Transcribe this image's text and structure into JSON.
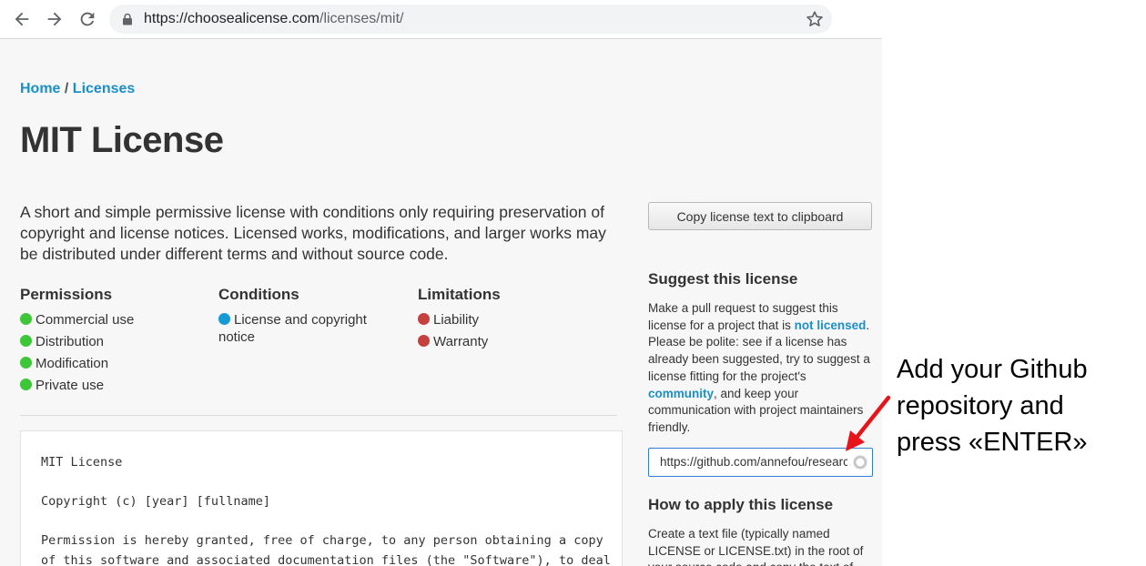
{
  "browser": {
    "url_host": "https://choosealicense.com",
    "url_path": "/licenses/mit/"
  },
  "breadcrumb": {
    "home": "Home",
    "separator": " / ",
    "licenses": "Licenses"
  },
  "page": {
    "title": "MIT License",
    "description": "A short and simple permissive license with conditions only requiring preservation of copyright and license notices. Licensed works, modifications, and larger works may be distributed under different terms and without source code."
  },
  "rules": {
    "permissions": {
      "heading": "Permissions",
      "items": [
        "Commercial use",
        "Distribution",
        "Modification",
        "Private use"
      ]
    },
    "conditions": {
      "heading": "Conditions",
      "items": [
        "License and copyright notice"
      ]
    },
    "limitations": {
      "heading": "Limitations",
      "items": [
        "Liability",
        "Warranty"
      ]
    }
  },
  "license_text": "MIT License\n\nCopyright (c) [year] [fullname]\n\nPermission is hereby granted, free of charge, to any person obtaining a copy\nof this software and associated documentation files (the \"Software\"), to deal",
  "sidebar": {
    "copy_button": "Copy license text to clipboard",
    "suggest": {
      "heading": "Suggest this license",
      "text_1": "Make a pull request to suggest this license for a project that is ",
      "link_1": "not licensed",
      "text_2": ". Please be polite: see if a license has already been suggested, try to suggest a license fitting for the project's ",
      "link_2": "community",
      "text_3": ", and keep your communication with project maintainers friendly.",
      "input_value": "https://github.com/annefou/research"
    },
    "apply": {
      "heading": "How to apply this license",
      "text": "Create a text file (typically named LICENSE or LICENSE.txt) in the root of your source code and copy the text of"
    }
  },
  "annotation": {
    "lines": [
      "Add your Github",
      "repository and",
      "press «ENTER»"
    ],
    "arrow_color": "#e8141b"
  },
  "colors": {
    "link": "#1a8fc9",
    "permission": "#3dc637",
    "condition": "#149ad4",
    "limitation": "#c6403d"
  }
}
